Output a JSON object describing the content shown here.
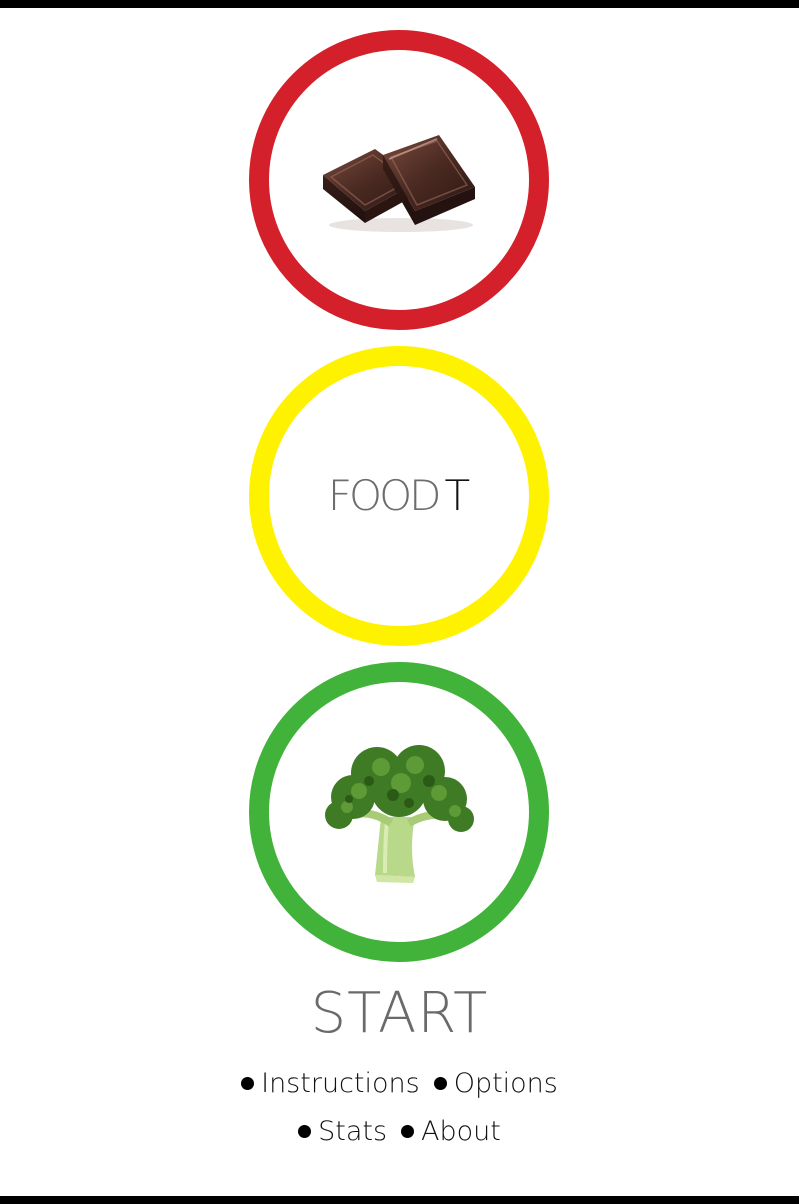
{
  "colors": {
    "red_ring": "#d3202a",
    "yellow_ring": "#fff200",
    "green_ring": "#41b23a"
  },
  "lights": {
    "top": {
      "image": "chocolate-image"
    },
    "middle": {
      "logo_part1": "FOOD",
      "logo_part2": "T"
    },
    "bottom": {
      "image": "broccoli-image"
    }
  },
  "start_label": "START",
  "menu": {
    "instructions": "Instructions",
    "options": "Options",
    "stats": "Stats",
    "about": "About"
  }
}
